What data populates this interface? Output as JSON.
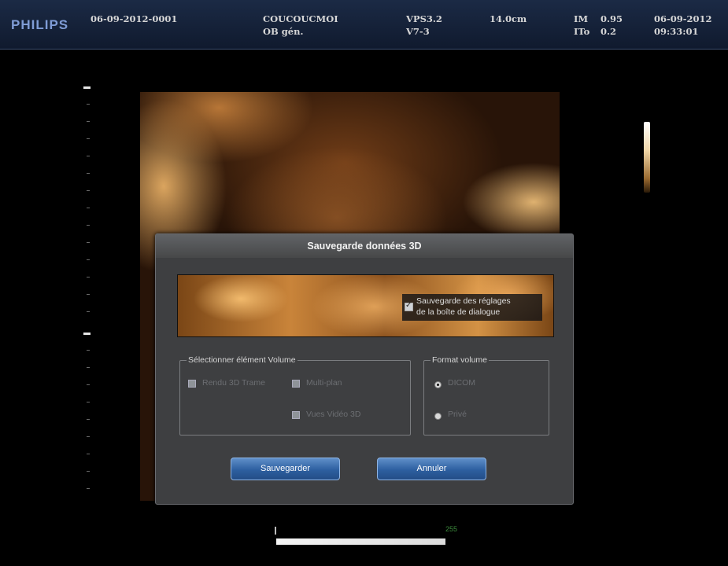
{
  "header": {
    "brand": "PHILIPS",
    "study_id": "06-09-2012-0001",
    "patient_name": "COUCOUCMOI",
    "exam_preset": "OB gén.",
    "software_version": "VPS3.2",
    "probe": "V7-3",
    "depth": "14.0cm",
    "mi_label": "IM",
    "mi_value": "0.95",
    "tis_label": "ITo",
    "tis_value": "0.2",
    "date": "06-09-2012",
    "time": "09:33:01"
  },
  "dialog": {
    "title": "Sauvegarde données 3D",
    "save_settings_label_line1": "Sauvegarde des réglages",
    "save_settings_label_line2": "de la boîte de dialogue",
    "save_settings_checked": true,
    "volume_group_label": "Sélectionner élément Volume",
    "volume_options_disabled": [
      {
        "label": "Rendu 3D Trame"
      },
      {
        "label": "Multi-plan"
      },
      {
        "label": "Vues Vidéo 3D"
      }
    ],
    "format_group_label": "Format volume",
    "format_options": [
      {
        "label": "DICOM",
        "selected": true
      },
      {
        "label": "Privé",
        "selected": false
      }
    ],
    "save_button": "Sauvegarder",
    "cancel_button": "Annuler"
  },
  "grayscale": {
    "max_label": "255"
  },
  "colors": {
    "header_bg": "#1b2a45",
    "brand": "#7f9cd6",
    "dialog_bg": "#3e3f41",
    "button": "#2d5fa0",
    "render_tint": "#c9843a"
  }
}
